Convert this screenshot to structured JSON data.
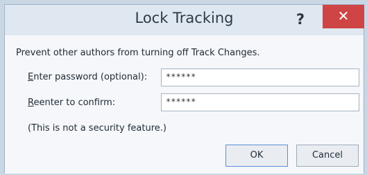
{
  "dialog": {
    "title": "Lock Tracking",
    "help_glyph": "?",
    "close_glyph": "✕"
  },
  "content": {
    "description": "Prevent other authors from turning off Track Changes.",
    "password_label_first": "E",
    "password_label_rest": "nter password (optional):",
    "password_value": "******",
    "confirm_label_first": "R",
    "confirm_label_rest": "eenter to confirm:",
    "confirm_value": "******",
    "note": "(This is not a security feature.)"
  },
  "buttons": {
    "ok_label": "OK",
    "cancel_label": "Cancel"
  },
  "colors": {
    "close_button": "#cf4444",
    "ok_focus_border": "#5b8fd3"
  },
  "icons": {
    "help": "help-icon",
    "close": "close-icon"
  }
}
